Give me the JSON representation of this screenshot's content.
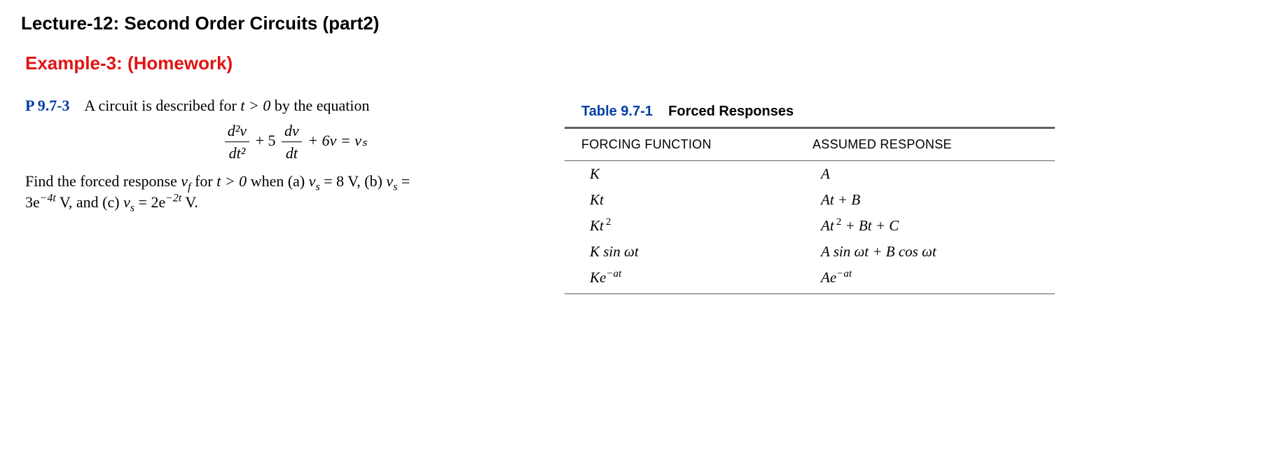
{
  "lecture_title": "Lecture-12: Second Order Circuits (part2)",
  "example_heading": "Example-3: (Homework)",
  "problem": {
    "number": "P 9.7-3",
    "intro_a": "A circuit is described for ",
    "intro_cond": "t > 0",
    "intro_b": " by the equation",
    "equation": "d²v/dt² + 5 dv/dt + 6v = vₛ",
    "eq_num1": "d²v",
    "eq_den1": "dt²",
    "eq_coef2": "+ 5",
    "eq_num2": "dv",
    "eq_den2": "dt",
    "eq_tail": "+ 6v = vₛ",
    "line2_a": "Find the forced response ",
    "line2_vf": "v_f",
    "line2_b": " for ",
    "line2_cond": "t > 0",
    "line2_c": " when (a) ",
    "line2_vs": "vₛ",
    "line2_d": " = 8 V, (b) ",
    "line2_e": " = ",
    "line3_a": "3e",
    "line3_exp1": "−4t",
    "line3_b": " V, and (c) ",
    "line3_c": " = 2e",
    "line3_exp2": "−2t",
    "line3_d": " V."
  },
  "table": {
    "number": "Table 9.7-1",
    "title": "Forced Responses",
    "head_left": "FORCING FUNCTION",
    "head_right": "ASSUMED RESPONSE",
    "rows": [
      {
        "forcing": "K",
        "response": "A"
      },
      {
        "forcing": "Kt",
        "response": "At + B"
      },
      {
        "forcing": "Kt²",
        "response": "At² + Bt + C"
      },
      {
        "forcing": "K sin ωt",
        "response": "A sin ωt + B cos ωt"
      },
      {
        "forcing": "Ke^{−at}",
        "response": "Ae^{−at}"
      }
    ]
  },
  "chart_data": {
    "type": "table",
    "title": "Table 9.7-1 Forced Responses",
    "columns": [
      "FORCING FUNCTION",
      "ASSUMED RESPONSE"
    ],
    "rows": [
      [
        "K",
        "A"
      ],
      [
        "Kt",
        "At + B"
      ],
      [
        "Kt^2",
        "At^2 + Bt + C"
      ],
      [
        "K sin ωt",
        "A sin ωt + B cos ωt"
      ],
      [
        "K e^{-at}",
        "A e^{-at}"
      ]
    ]
  }
}
